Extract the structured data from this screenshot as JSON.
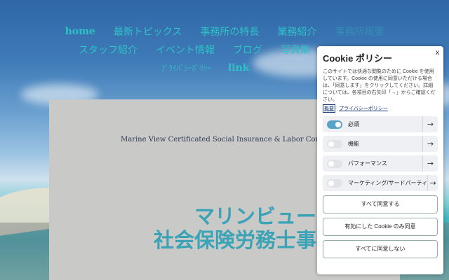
{
  "nav": {
    "row1": [
      "home",
      "最新トピックス",
      "事務所の特長",
      "業務紹介",
      "事務所概要"
    ],
    "row2": [
      "スタッフ紹介",
      "イベント情報",
      "ブログ",
      "写真集",
      ""
    ],
    "row3": [
      "ﾌﾟﾗｲﾊﾞｼｰﾎﾟﾘｼｰ",
      "link"
    ]
  },
  "panel": {
    "subtitle": "Marine View Certificated Social Insurance & Labor Consultant Office",
    "title_line1": "マリンビュー",
    "title_line2": "社会保険労務士事務所"
  },
  "cookie": {
    "title": "Cookie ポリシー",
    "close": "x",
    "description": "このサイトでは快適な閲覧のために Cookie を使用しています。Cookie の使用に同意いただける場合は、「同意します」をクリックしてください。詳細については、各項目の右矢印「→」からご確認ください。",
    "links": {
      "summary": "概要",
      "privacy": "プライバシーポリシー"
    },
    "categories": [
      {
        "label": "必須",
        "on": true
      },
      {
        "label": "機能",
        "on": false
      },
      {
        "label": "パフォーマンス",
        "on": false
      },
      {
        "label": "マーケティング/サードパーティ",
        "on": false
      }
    ],
    "buttons": {
      "accept_all": "すべて同意する",
      "accept_selected": "有効にした Cookie のみ同意",
      "reject_all": "すべてに同意しない"
    },
    "arrow_glyph": "→"
  }
}
